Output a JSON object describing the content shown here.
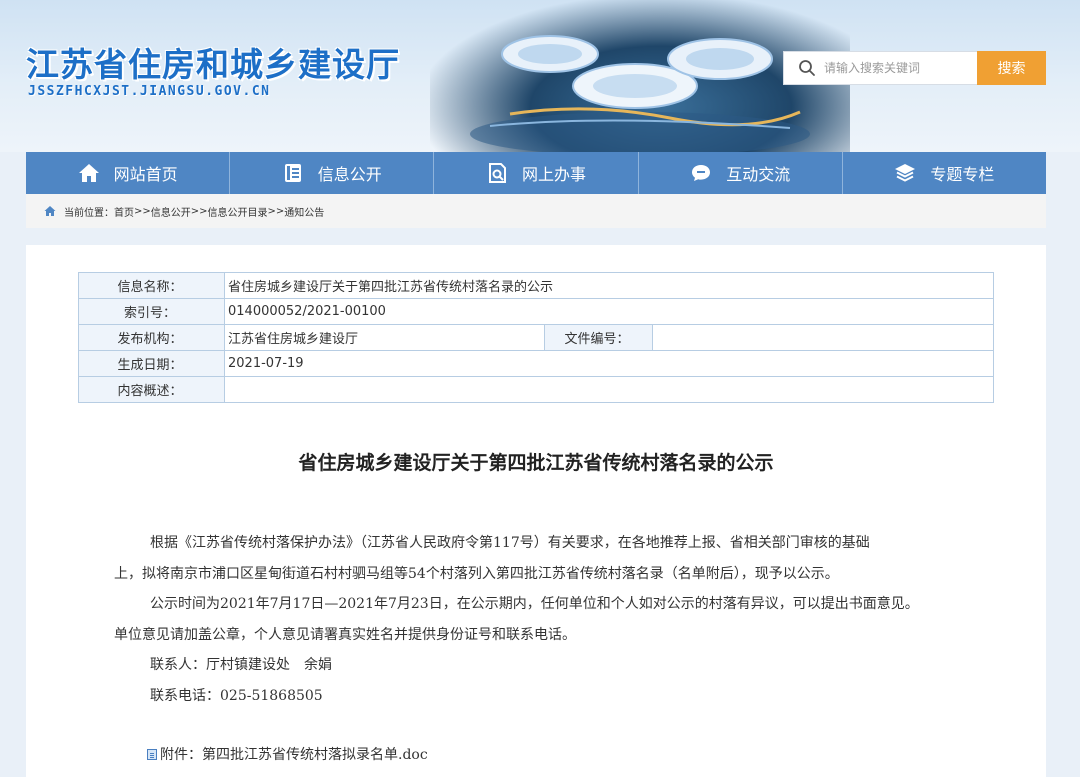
{
  "header": {
    "title": "江苏省住房和城乡建设厅",
    "domain": "JSSZFHCXJST.JIANGSU.GOV.CN",
    "search": {
      "placeholder": "请输入搜索关键词",
      "button": "搜索"
    }
  },
  "nav": [
    {
      "label": "网站首页",
      "icon": "home-icon"
    },
    {
      "label": "信息公开",
      "icon": "document-list-icon"
    },
    {
      "label": "网上办事",
      "icon": "search-document-icon"
    },
    {
      "label": "互动交流",
      "icon": "chat-bubble-icon"
    },
    {
      "label": "专题专栏",
      "icon": "layers-icon"
    }
  ],
  "breadcrumb": {
    "prefix": "当前位置：",
    "items": [
      "首页",
      "信息公开",
      "信息公开目录",
      "通知公告"
    ],
    "separator": ">>"
  },
  "meta": {
    "name_label": "信息名称：",
    "name_value": "省住房城乡建设厅关于第四批江苏省传统村落名录的公示",
    "index_label": "索引号：",
    "index_value": "014000052/2021-00100",
    "publisher_label": "发布机构：",
    "publisher_value": "江苏省住房城乡建设厅",
    "docno_label": "文件编号：",
    "docno_value": "",
    "date_label": "生成日期：",
    "date_value": "2021-07-19",
    "summary_label": "内容概述：",
    "summary_value": ""
  },
  "article": {
    "title": "省住房城乡建设厅关于第四批江苏省传统村落名录的公示",
    "para1_line1": "根据《江苏省传统村落保护办法》（江苏省人民政府令第117号）有关要求，在各地推荐上报、省相关部门审核的基础",
    "para1_line2": "上，拟将南京市浦口区星甸街道石村村驷马组等54个村落列入第四批江苏省传统村落名录（名单附后），现予以公示。",
    "para2_line1": "公示时间为2021年7月17日—2021年7月23日，在公示期内，任何单位和个人如对公示的村落有异议，可以提出书面意见。",
    "para2_line2": "单位意见请加盖公章，个人意见请署真实姓名并提供身份证号和联系电话。",
    "contact": "联系人：厅村镇建设处　余娟",
    "phone": "联系电话：025-51868505",
    "attachment_label": "附件：",
    "attachment_name": "第四批江苏省传统村落拟录名单.doc"
  },
  "colors": {
    "brand_blue": "#1d6fc7",
    "nav_bg": "#4f86c4",
    "search_button": "#f0a033",
    "table_border": "#b7cde3"
  }
}
